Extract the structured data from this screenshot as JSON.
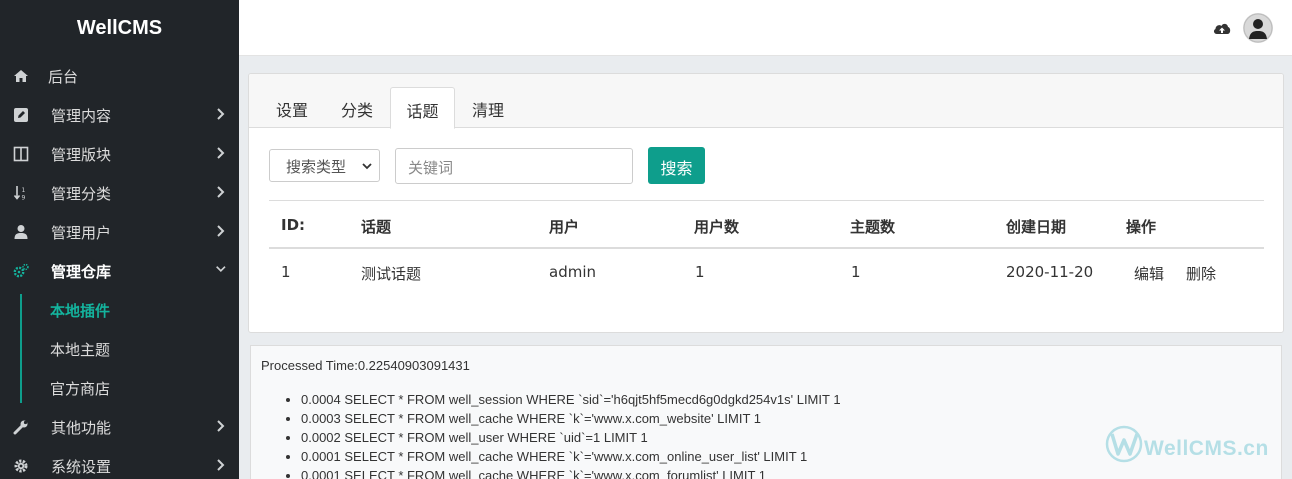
{
  "brand": "WellCMS",
  "sidebar": {
    "items": [
      {
        "label": "后台",
        "icon": "home-icon"
      },
      {
        "label": "管理内容",
        "icon": "edit-icon"
      },
      {
        "label": "管理版块",
        "icon": "columns-icon"
      },
      {
        "label": "管理分类",
        "icon": "sort-icon"
      },
      {
        "label": "管理用户",
        "icon": "user-icon"
      },
      {
        "label": "管理仓库",
        "icon": "cogs-icon"
      },
      {
        "label": "其他功能",
        "icon": "wrench-icon"
      },
      {
        "label": "系统设置",
        "icon": "gear-icon"
      }
    ],
    "submenu": [
      "本地插件",
      "本地主题",
      "官方商店"
    ]
  },
  "tabs": [
    "设置",
    "分类",
    "话题",
    "清理"
  ],
  "search": {
    "type_label": "搜索类型",
    "placeholder": "关键词",
    "button": "搜索"
  },
  "table": {
    "headers": [
      "ID:",
      "话题",
      "用户",
      "用户数",
      "主题数",
      "创建日期",
      "操作"
    ],
    "rows": [
      {
        "id": "1",
        "topic": "测试话题",
        "user": "admin",
        "user_count": "1",
        "thread_count": "1",
        "created": "2020-11-20",
        "edit": "编辑",
        "delete": "删除"
      }
    ]
  },
  "debug": {
    "processed_time": "Processed Time:0.22540903091431",
    "queries": [
      "0.0004 SELECT * FROM well_session WHERE `sid`='h6qjt5hf5mecd6g0dgkd254v1s' LIMIT 1",
      "0.0003 SELECT * FROM well_cache WHERE `k`='www.x.com_website' LIMIT 1",
      "0.0002 SELECT * FROM well_user WHERE `uid`=1 LIMIT 1",
      "0.0001 SELECT * FROM well_cache WHERE `k`='www.x.com_online_user_list' LIMIT 1",
      "0.0001 SELECT * FROM well_cache WHERE `k`='www.x.com_forumlist' LIMIT 1"
    ]
  },
  "watermark": "WellCMS.cn",
  "colors": {
    "accent": "#0e9e8c",
    "sidebar_bg": "#212529"
  }
}
